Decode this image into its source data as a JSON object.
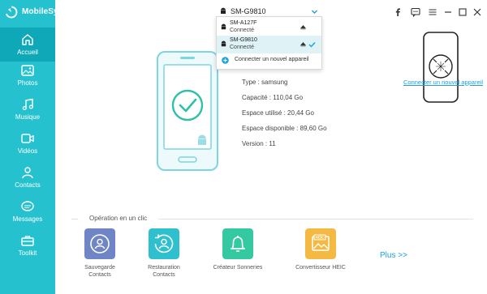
{
  "app": {
    "name": "MobileSync",
    "accent_color": "#26c1cf"
  },
  "sidebar": {
    "items": [
      {
        "label": "Accueil",
        "icon": "home-icon",
        "active": true
      },
      {
        "label": "Photos",
        "icon": "photo-icon",
        "active": false
      },
      {
        "label": "Musique",
        "icon": "music-icon",
        "active": false
      },
      {
        "label": "Vidéos",
        "icon": "video-icon",
        "active": false
      },
      {
        "label": "Contacts",
        "icon": "contacts-icon",
        "active": false
      },
      {
        "label": "Messages",
        "icon": "messages-icon",
        "active": false
      },
      {
        "label": "Toolkit",
        "icon": "toolkit-icon",
        "active": false
      }
    ]
  },
  "device_selector": {
    "selected": "SM-G9810",
    "options": [
      {
        "name": "SM-A127F",
        "status": "Connecté",
        "selected": false
      },
      {
        "name": "SM-G9810",
        "status": "Connecté",
        "selected": true
      }
    ],
    "connect_label": "Connecter un nouvel appareil"
  },
  "device_info": {
    "type": {
      "label": "Type :",
      "value": "samsung"
    },
    "capacity": {
      "label": "Capacité :",
      "value": "110,04 Go"
    },
    "used": {
      "label": "Espace utilisé :",
      "value": "20,44 Go"
    },
    "available": {
      "label": "Espace disponible :",
      "value": "89,60 Go"
    },
    "version": {
      "label": "Version :",
      "value": "11"
    }
  },
  "connect_new_device_link": "Connecter un nouvel appareil",
  "operations": {
    "title": "Opération en un clic",
    "items": [
      {
        "label_line1": "Sauvegarde",
        "label_line2": "Contacts",
        "color": "#6f85c6",
        "icon": "backup-contacts-icon"
      },
      {
        "label_line1": "Restauration",
        "label_line2": "Contacts",
        "color": "#2ec0cf",
        "icon": "restore-contacts-icon"
      },
      {
        "label_line1": "Créateur Sonneries",
        "label_line2": "",
        "color": "#35c9a2",
        "icon": "bell-icon"
      },
      {
        "label_line1": "Convertisseur HEIC",
        "label_line2": "",
        "color": "#f4b942",
        "icon": "heic-image-icon"
      }
    ],
    "more": "Plus >>"
  },
  "window_controls": [
    "facebook-icon",
    "chat-icon",
    "menu-icon",
    "minimize-icon",
    "maximize-icon",
    "close-icon"
  ]
}
